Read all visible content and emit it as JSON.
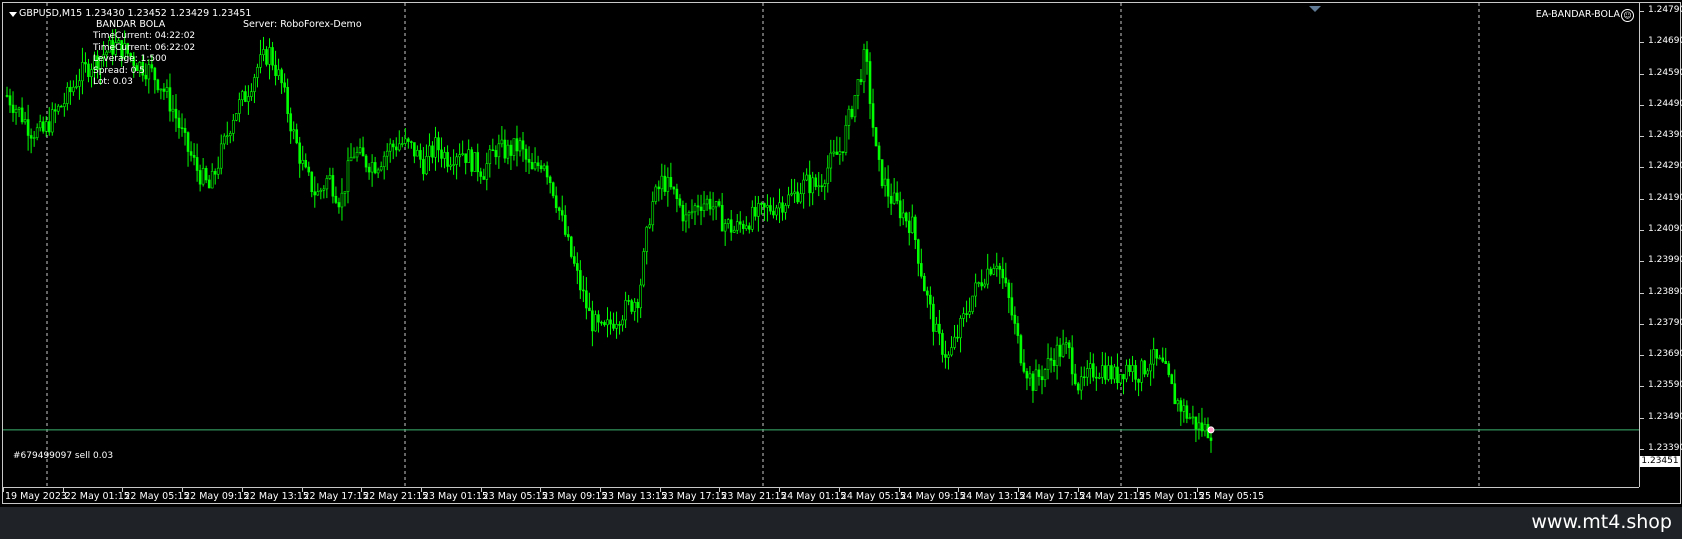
{
  "header": {
    "symbol_line": "GBPUSD,M15  1.23430 1.23452 1.23429 1.23451",
    "ea_title": "BANDAR BOLA",
    "server_label": "Server:  RoboForex-Demo",
    "ea_name": "EA-BANDAR-BOLA",
    "smiley_icon": "☺"
  },
  "info_panel": [
    "TimeCurrent:  04:22:02",
    "TimeCurrent:  06:22:02",
    "Leverage:  1:500",
    "Spread:  0.5",
    "Lot:      0.03"
  ],
  "order_line": {
    "label": "#679499097 sell 0.03",
    "price": 1.23451,
    "price_text": "1.23451",
    "color": "#3cb371"
  },
  "price_axis": {
    "labels": [
      "1.24790",
      "1.24690",
      "1.24590",
      "1.24490",
      "1.24390",
      "1.24290",
      "1.24190",
      "1.24090",
      "1.23990",
      "1.23890",
      "1.23790",
      "1.23690",
      "1.23590",
      "1.23490",
      "1.23390"
    ]
  },
  "time_axis": {
    "labels": [
      "19 May 2023",
      "22 May 01:15",
      "22 May 05:15",
      "22 May 09:15",
      "22 May 13:15",
      "22 May 17:15",
      "22 May 21:15",
      "23 May 01:15",
      "23 May 05:15",
      "23 May 09:15",
      "23 May 13:15",
      "23 May 17:15",
      "23 May 21:15",
      "24 May 01:15",
      "24 May 05:15",
      "24 May 09:15",
      "24 May 13:15",
      "24 May 17:15",
      "24 May 21:15",
      "25 May 01:15",
      "25 May 05:15"
    ]
  },
  "chart_data": {
    "type": "candlestick",
    "symbol": "GBPUSD",
    "timeframe": "M15",
    "ylim": [
      1.2335,
      1.248
    ],
    "close_series": [
      1.2452,
      1.2447,
      1.2441,
      1.244,
      1.2446,
      1.2451,
      1.2458,
      1.2462,
      1.2465,
      1.2468,
      1.2466,
      1.2462,
      1.246,
      1.2455,
      1.2447,
      1.2436,
      1.2428,
      1.2422,
      1.2434,
      1.2446,
      1.2452,
      1.2461,
      1.2466,
      1.2456,
      1.244,
      1.2427,
      1.242,
      1.2426,
      1.2418,
      1.2434,
      1.2431,
      1.243,
      1.2435,
      1.2437,
      1.2435,
      1.243,
      1.2436,
      1.2432,
      1.2435,
      1.2431,
      1.2428,
      1.2435,
      1.2434,
      1.2436,
      1.2427,
      1.2432,
      1.242,
      1.2405,
      1.2392,
      1.238,
      1.2376,
      1.2381,
      1.2384,
      1.2388,
      1.2416,
      1.2425,
      1.242,
      1.2412,
      1.2418,
      1.2418,
      1.2412,
      1.2409,
      1.2412,
      1.2414,
      1.2416,
      1.2418,
      1.242,
      1.2424,
      1.2423,
      1.243,
      1.2435,
      1.245,
      1.2465,
      1.243,
      1.242,
      1.2415,
      1.241,
      1.239,
      1.2375,
      1.2368,
      1.2378,
      1.2388,
      1.2395,
      1.24,
      1.2387,
      1.237,
      1.236,
      1.2364,
      1.237,
      1.2371,
      1.2358,
      1.2364,
      1.2365,
      1.2362,
      1.2366,
      1.2363,
      1.2368,
      1.2365,
      1.2355,
      1.235,
      1.2346,
      1.2345
    ]
  },
  "footer": {
    "site": "www.mt4.shop"
  },
  "colors": {
    "bull": "#00ff00",
    "bear": "#00ff00",
    "grid": "#c8c8c8",
    "background": "#000000"
  }
}
